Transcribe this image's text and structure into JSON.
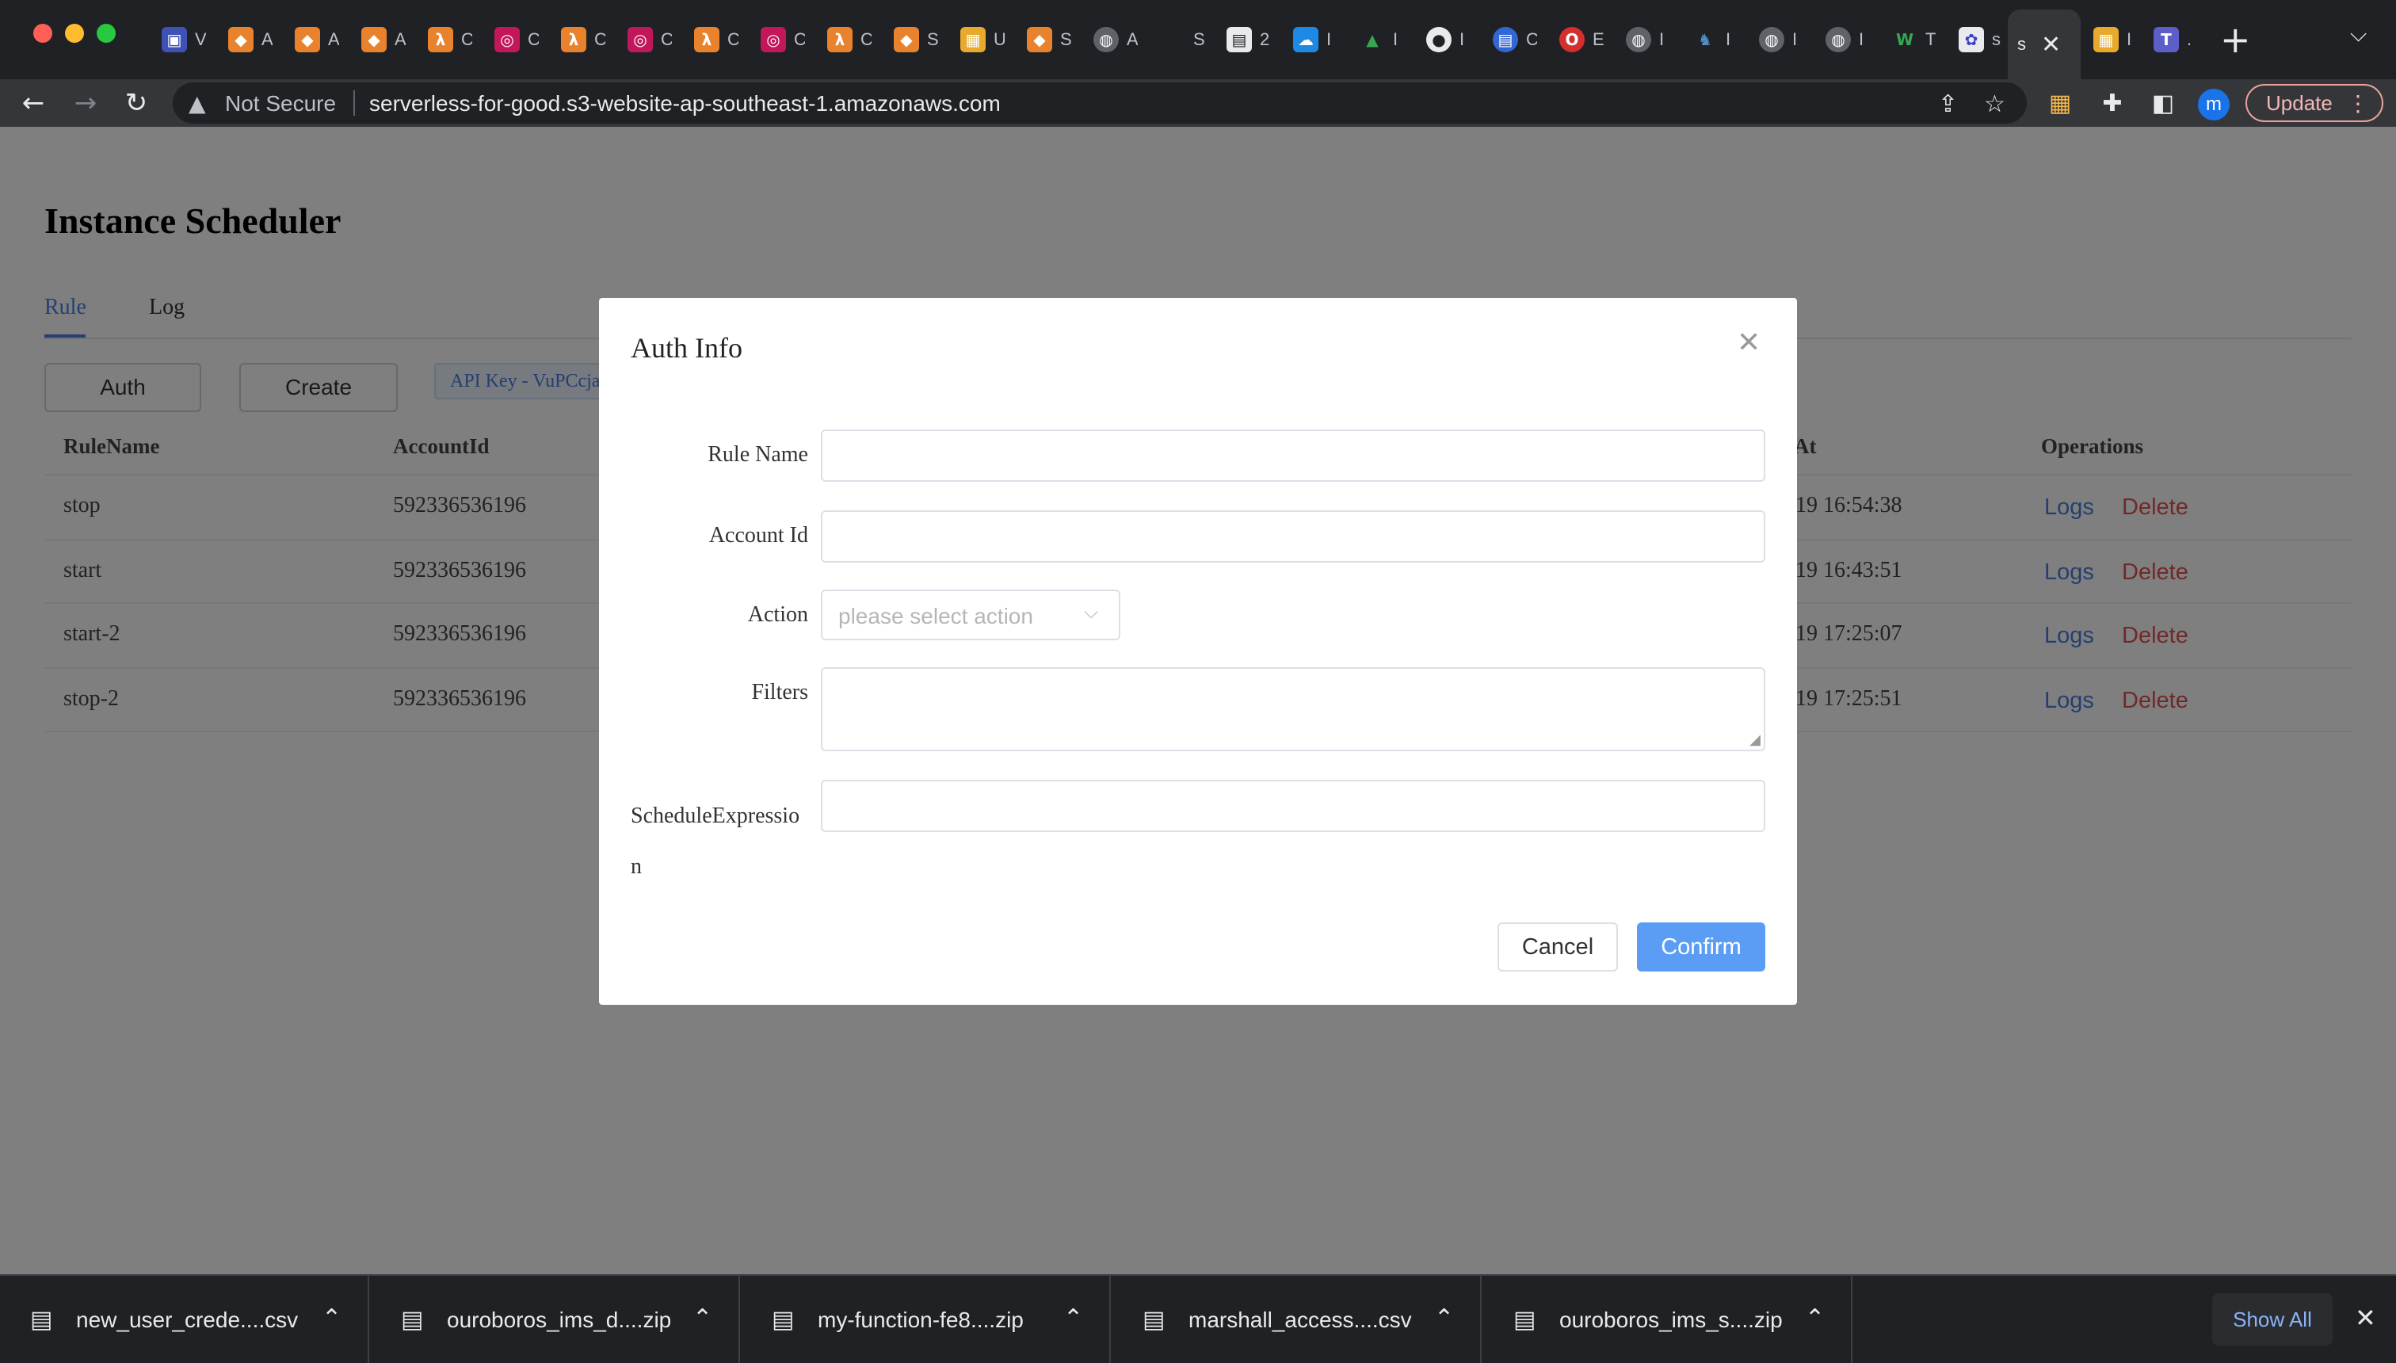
{
  "browser": {
    "tab_titles": [
      "V",
      "A",
      "A",
      "A",
      "C",
      "C",
      "C",
      "C",
      "C",
      "C",
      "C",
      "S",
      "U",
      "S",
      "A",
      "S",
      "2",
      "I",
      "I",
      "I",
      "C",
      "E",
      "I",
      "I",
      "I",
      "I",
      "T",
      "s",
      "I",
      "."
    ],
    "active_tab_index": 27,
    "new_tab_icon": "plus-icon",
    "url_warning": "Not Secure",
    "url": "serverless-for-good.s3-website-ap-southeast-1.amazonaws.com",
    "profile_initial": "m",
    "update_label": "Update"
  },
  "page": {
    "title": "Instance Scheduler",
    "tabs": {
      "rule": "Rule",
      "log": "Log"
    },
    "buttons": {
      "auth": "Auth",
      "create": "Create"
    },
    "api_key_tag": "API Key - VuPCcja",
    "table": {
      "headers": {
        "rule_name": "RuleName",
        "account_id": "AccountId",
        "at": "At",
        "operations": "Operations"
      },
      "rows": [
        {
          "name": "stop",
          "account": "592336536196",
          "time": "19 16:54:38",
          "logs": "Logs",
          "delete": "Delete"
        },
        {
          "name": "start",
          "account": "592336536196",
          "time": "19 16:43:51",
          "logs": "Logs",
          "delete": "Delete"
        },
        {
          "name": "start-2",
          "account": "592336536196",
          "time": "19 17:25:07",
          "logs": "Logs",
          "delete": "Delete"
        },
        {
          "name": "stop-2",
          "account": "592336536196",
          "time": "19 17:25:51",
          "logs": "Logs",
          "delete": "Delete"
        }
      ]
    }
  },
  "modal": {
    "title": "Auth Info",
    "fields": {
      "rule_name": {
        "label": "Rule Name",
        "value": ""
      },
      "account_id": {
        "label": "Account Id",
        "value": ""
      },
      "action": {
        "label": "Action",
        "placeholder": "please select action"
      },
      "filters": {
        "label": "Filters",
        "value": ""
      },
      "schedule": {
        "label": "ScheduleExpression",
        "value": ""
      }
    },
    "cancel": "Cancel",
    "confirm": "Confirm"
  },
  "downloads": {
    "items": [
      {
        "name": "new_user_crede....csv"
      },
      {
        "name": "ouroboros_ims_d....zip"
      },
      {
        "name": "my-function-fe8....zip"
      },
      {
        "name": "marshall_access....csv"
      },
      {
        "name": "ouroboros_ims_s....zip"
      }
    ],
    "show_all": "Show All"
  },
  "colors": {
    "accent": "#4a7ee0",
    "danger": "#e05252",
    "confirm": "#5b9df5",
    "chrome_dark": "#202124"
  }
}
